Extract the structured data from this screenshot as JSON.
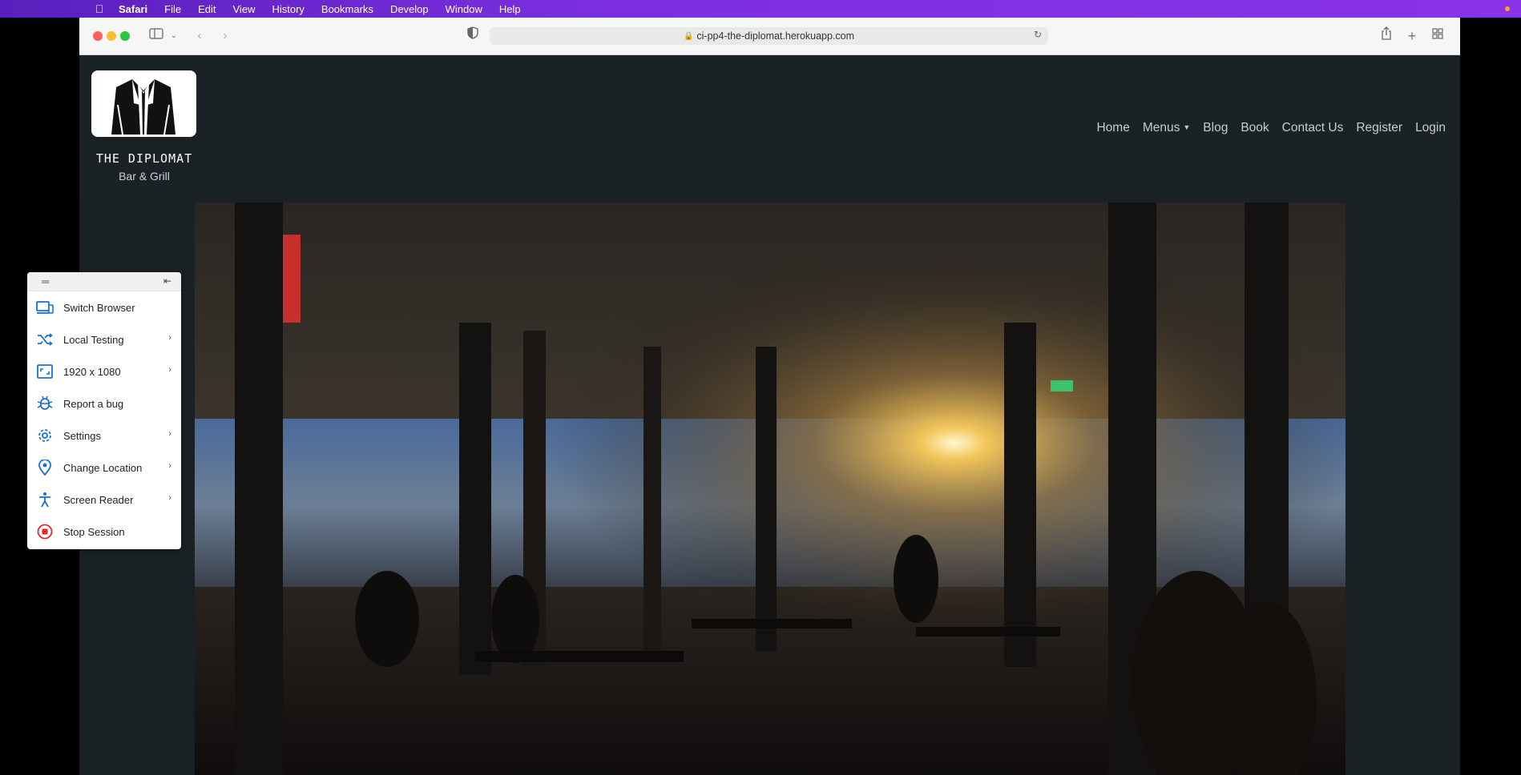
{
  "menubar": {
    "app": "Safari",
    "items": [
      "File",
      "Edit",
      "View",
      "History",
      "Bookmarks",
      "Develop",
      "Window",
      "Help"
    ]
  },
  "browser": {
    "url": "ci-pp4-the-diplomat.herokuapp.com"
  },
  "site": {
    "brand_name": "THE DIPLOMAT",
    "brand_sub": "Bar & Grill",
    "nav": {
      "home": "Home",
      "menus": "Menus",
      "blog": "Blog",
      "book": "Book",
      "contact": "Contact Us",
      "register": "Register",
      "login": "Login"
    }
  },
  "panel": {
    "items": [
      {
        "label": "Switch Browser",
        "icon": "devices-icon"
      },
      {
        "label": "Local Testing",
        "icon": "shuffle-icon"
      },
      {
        "label": "1920 x 1080",
        "icon": "resolution-icon"
      },
      {
        "label": "Report a bug",
        "icon": "bug-icon"
      },
      {
        "label": "Settings",
        "icon": "gear-icon"
      },
      {
        "label": "Change Location",
        "icon": "location-pin-icon"
      },
      {
        "label": "Screen Reader",
        "icon": "accessibility-icon"
      },
      {
        "label": "Stop Session",
        "icon": "stop-icon"
      }
    ],
    "accent": "#1a6fd6",
    "stop_color": "#e02b2b"
  }
}
